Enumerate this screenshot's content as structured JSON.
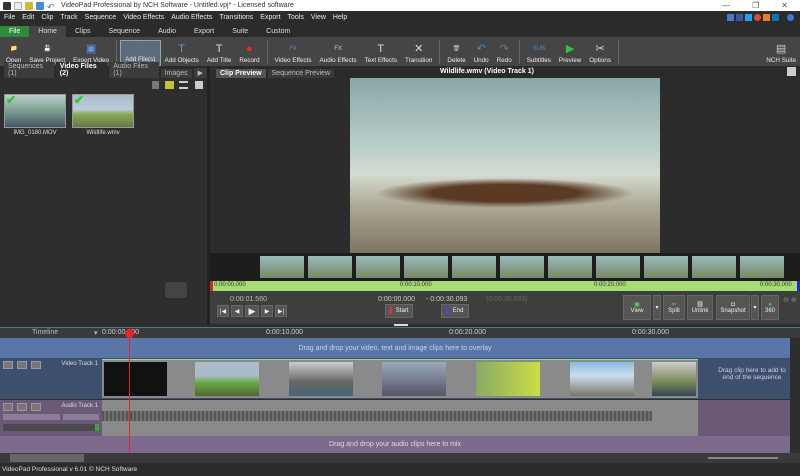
{
  "window": {
    "title": "VideoPad Professional by NCH Software - Untitled.vpj* - Licensed software",
    "min": "—",
    "max": "❐",
    "close": "✕"
  },
  "menu": [
    "File",
    "Edit",
    "Clip",
    "Track",
    "Sequence",
    "Video Effects",
    "Audio Effects",
    "Transitions",
    "Export",
    "Tools",
    "View",
    "Help"
  ],
  "ribbon_tabs": [
    "File",
    "Home",
    "Clips",
    "Sequence",
    "Audio",
    "Export",
    "Suite",
    "Custom"
  ],
  "toolbar": [
    {
      "label": "Open",
      "icon": "folder-icon",
      "glyph": "📁",
      "color": "#d8b830"
    },
    {
      "label": "Save Project",
      "icon": "save-icon",
      "glyph": "💾",
      "color": "#4a8ad0"
    },
    {
      "label": "Export Video",
      "icon": "export-video-icon",
      "glyph": "▣",
      "color": "#5a9ae0"
    },
    {
      "label": "Add File(s)",
      "icon": "add-files-icon",
      "glyph": "♪",
      "color": "#3a7ad0"
    },
    {
      "label": "Add Objects",
      "icon": "add-objects-icon",
      "glyph": "T",
      "color": "#5a9ad0"
    },
    {
      "label": "Add Title",
      "icon": "add-title-icon",
      "glyph": "T",
      "color": "#ddd"
    },
    {
      "label": "Record",
      "icon": "record-icon",
      "glyph": "●",
      "color": "#e03020"
    },
    {
      "label": "Video Effects",
      "icon": "video-effects-icon",
      "glyph": "FX",
      "color": "#5a8ad0"
    },
    {
      "label": "Audio Effects",
      "icon": "audio-effects-icon",
      "glyph": "FX",
      "color": "#ccc"
    },
    {
      "label": "Text Effects",
      "icon": "text-effects-icon",
      "glyph": "T",
      "color": "#ddd"
    },
    {
      "label": "Transition",
      "icon": "transition-icon",
      "glyph": "✕",
      "color": "#ddd"
    },
    {
      "label": "Delete",
      "icon": "trash-icon",
      "glyph": "🗑",
      "color": "#ccc"
    },
    {
      "label": "Undo",
      "icon": "undo-icon",
      "glyph": "↶",
      "color": "#3a8ae0"
    },
    {
      "label": "Redo",
      "icon": "redo-icon",
      "glyph": "↷",
      "color": "#777"
    },
    {
      "label": "Subtitles",
      "icon": "subtitles-icon",
      "glyph": "SUB",
      "color": "#4a8ad0"
    },
    {
      "label": "Preview",
      "icon": "preview-icon",
      "glyph": "▶",
      "color": "#3ac04a"
    },
    {
      "label": "Options",
      "icon": "options-icon",
      "glyph": "✂",
      "color": "#ddd"
    },
    {
      "label": "NCH Suite",
      "icon": "nch-suite-icon",
      "glyph": "▤",
      "color": "#ccc"
    }
  ],
  "bin": {
    "tabs": [
      "Sequences (1)",
      "Video Files (2)",
      "Audio Files (1)",
      "Images"
    ],
    "more": "▶",
    "clips": [
      {
        "name": "IMG_0180.MOV"
      },
      {
        "name": "Wildlife.wmv"
      }
    ]
  },
  "preview": {
    "tabs": [
      "Clip Preview",
      "Sequence Preview"
    ],
    "title": "Wildlife.wmv (Video Track 1)",
    "ruler_ticks": [
      "0:00:00.000",
      "0:00:10.000",
      "0:00:20.000",
      "0:00:30.000"
    ],
    "current_time": "0:00:01.560",
    "start_time": "0:00:00.000",
    "end_time": "- 0:00:30.093",
    "duration": "(0:00:30.093)",
    "start_label": "Start",
    "end_label": "End",
    "view_label": "View",
    "split_label": "Split",
    "unlink_label": "Unlink",
    "snapshot_label": "Snapshot",
    "vr_label": "360"
  },
  "timeline": {
    "label": "Timeline",
    "ticks": [
      "0:00:00.000",
      "0:00:10.000",
      "0:00:20.000",
      "0:00:30.000"
    ],
    "overlay_hint": "Drag and drop your video, text and image clips here to overlay",
    "video_track": "Video Track 1",
    "audio_track": "Audio Track 1",
    "end_hint": "Drag clip here to add to end of the sequence",
    "audio_hint": "Drag and drop your audio clips here to mix"
  },
  "status": "VideoPad Professional v 6.01 © NCH Software"
}
